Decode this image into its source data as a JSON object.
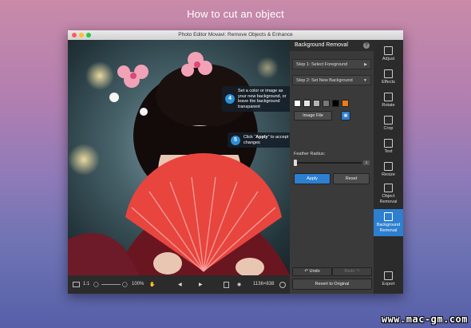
{
  "tutorial": {
    "heading": "How to cut an object"
  },
  "window": {
    "title": "Photo Editor Movavi: Remove Objects & Enhance"
  },
  "tips": [
    {
      "number": "4",
      "text": "Set a color or image as your new background, or leave the background transparent"
    },
    {
      "number": "5",
      "text_before": "Click “",
      "emphasis": "Apply",
      "text_after": "” to accept the changes"
    }
  ],
  "panel": {
    "title": "Background Removal",
    "help": "?",
    "step1": "Step 1: Select Foreground",
    "step2": "Step 2: Set New Background",
    "swatches": [
      "#ffffff",
      "#e6e6e6",
      "#b3b3b3",
      "#777777",
      "#000000",
      "#f07a1a"
    ],
    "image_file": "Image File",
    "feather_label": "Feather Radius:",
    "feather_value": "1",
    "apply": "Apply",
    "reset": "Reset",
    "undo": "Undo",
    "redo": "Redo",
    "revert": "Revert to Original"
  },
  "bottombar": {
    "ratio": "1:1",
    "zoom": "100%",
    "size": "1136×838"
  },
  "tools": [
    {
      "label": "Adjust",
      "icon": "sliders-icon"
    },
    {
      "label": "Effects",
      "icon": "effects-icon"
    },
    {
      "label": "Rotate",
      "icon": "rotate-icon"
    },
    {
      "label": "Crop",
      "icon": "crop-icon"
    },
    {
      "label": "Text",
      "icon": "text-icon"
    },
    {
      "label": "Resize",
      "icon": "resize-icon"
    },
    {
      "label": "Object\nRemoval",
      "icon": "object-removal-icon"
    },
    {
      "label": "Background\nRemoval",
      "icon": "background-removal-icon",
      "active": true
    },
    {
      "label": "Export",
      "icon": "export-icon"
    }
  ],
  "watermark": "www.mac-gm.com",
  "colors": {
    "accent": "#2d7fd0",
    "tip_number": "#2d8fd6",
    "fan": "#e8453f"
  }
}
